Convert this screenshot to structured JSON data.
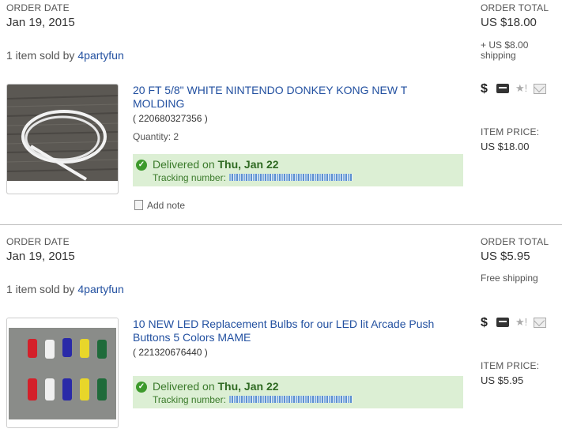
{
  "orders": [
    {
      "order_date_label": "ORDER DATE",
      "order_date": "Jan 19, 2015",
      "order_total_label": "ORDER TOTAL",
      "order_total": "US $18.00",
      "shipping_line1": "+ US $8.00",
      "shipping_line2": "shipping",
      "items_sold_by": "1 item sold by",
      "seller": "4partyfun",
      "item_title_line1": "20 FT 5/8\" WHITE NINTENDO DONKEY KONG NEW T",
      "item_title_line2": "MOLDING",
      "item_number": "( 220680327356 )",
      "quantity": "Quantity: 2",
      "delivered_prefix": "Delivered on",
      "delivered_date": "Thu, Jan 22",
      "tracking_label": "Tracking number:",
      "item_price_label": "ITEM PRICE:",
      "item_price": "US $18.00",
      "add_note": "Add note"
    },
    {
      "order_date_label": "ORDER DATE",
      "order_date": "Jan 19, 2015",
      "order_total_label": "ORDER TOTAL",
      "order_total": "US $5.95",
      "shipping_line1": "Free shipping",
      "items_sold_by": "1 item sold by",
      "seller": "4partyfun",
      "item_title_line1": "10 NEW LED Replacement Bulbs for our LED lit Arcade Push",
      "item_title_line2": "Buttons 5 Colors MAME",
      "item_number": "( 221320676440 )",
      "delivered_prefix": "Delivered on",
      "delivered_date": "Thu, Jan 22",
      "tracking_label": "Tracking number:",
      "item_price_label": "ITEM PRICE:",
      "item_price": "US $5.95"
    }
  ],
  "icons": [
    "dollar-icon",
    "package-icon",
    "feedback-icon",
    "message-icon"
  ],
  "colors": {
    "link": "#2250a0",
    "delivered_bg": "#dcefd4",
    "check": "#3d9a2c"
  }
}
